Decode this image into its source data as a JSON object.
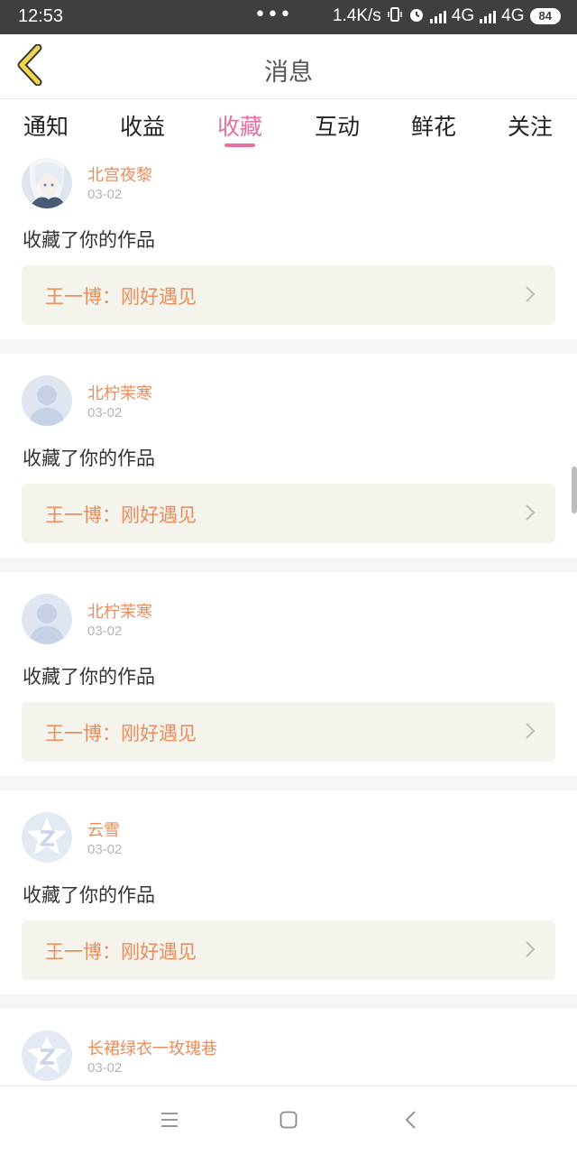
{
  "status_bar": {
    "time": "12:53",
    "dots": "•••",
    "speed": "1.4K/s",
    "network1": "4G",
    "network2": "4G",
    "battery": "84",
    "icons": [
      "vibrate-icon",
      "alarm-icon",
      "hd-signal-icon",
      "signal-icon"
    ]
  },
  "header": {
    "title": "消息",
    "back_icon": "chevron-left-icon",
    "accent_color": "#f2d64b"
  },
  "tabs": [
    {
      "label": "通知",
      "active": false
    },
    {
      "label": "收益",
      "active": false
    },
    {
      "label": "收藏",
      "active": true
    },
    {
      "label": "互动",
      "active": false
    },
    {
      "label": "鲜花",
      "active": false
    },
    {
      "label": "关注",
      "active": false
    }
  ],
  "tab_active_color": "#e86fa0",
  "messages": [
    {
      "username": "北宫夜黎",
      "date": "03-02",
      "text": "收藏了你的作品",
      "work": "王一博：刚好遇见",
      "avatar": "anime-avatar"
    },
    {
      "username": "北柠茉寒",
      "date": "03-02",
      "text": "收藏了你的作品",
      "work": "王一博：刚好遇见",
      "avatar": "default-person-avatar"
    },
    {
      "username": "北柠茉寒",
      "date": "03-02",
      "text": "收藏了你的作品",
      "work": "王一博：刚好遇见",
      "avatar": "default-person-avatar"
    },
    {
      "username": "云雪",
      "date": "03-02",
      "text": "收藏了你的作品",
      "work": "王一博：刚好遇见",
      "avatar": "default-z-avatar"
    },
    {
      "username": "长裙绿衣一玫瑰巷",
      "date": "03-02",
      "text": "",
      "work": "",
      "avatar": "default-z-avatar"
    }
  ],
  "name_color": "#e98d5d",
  "nav": {
    "icons": [
      "menu-icon",
      "home-square-icon",
      "back-icon"
    ]
  }
}
